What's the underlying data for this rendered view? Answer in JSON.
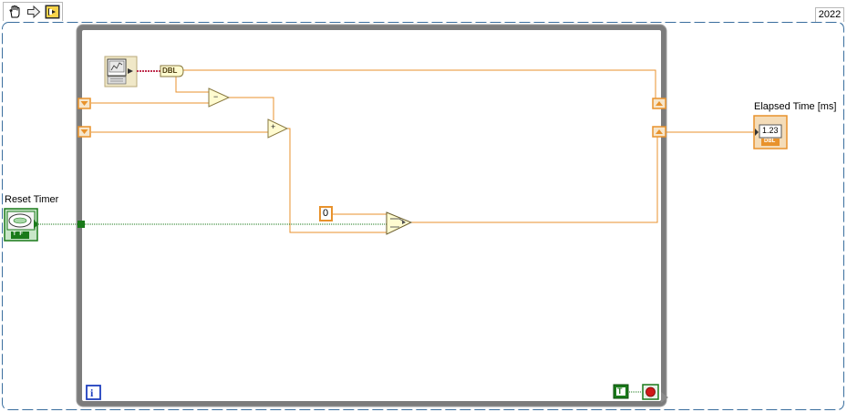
{
  "toolbar": {
    "buttons": [
      {
        "icon": "hand-operate-icon"
      },
      {
        "icon": "arrow-run-icon"
      },
      {
        "icon": "run-continuous-icon"
      }
    ]
  },
  "version": "2022",
  "controls": {
    "reset_timer_label": "Reset Timer",
    "reset_timer_boolean": "T F"
  },
  "indicators": {
    "elapsed_time_label": "Elapsed Time [ms]",
    "elapsed_time_display": "1.23",
    "elapsed_time_type": "DBL"
  },
  "diagram": {
    "tick_type": "DBL",
    "zero_constant": "0",
    "subtract_symbol": "−",
    "add_symbol": "+",
    "iteration_terminal": "i",
    "true_constant": "T"
  },
  "colors": {
    "orange_wire": "#e8922c",
    "green_wire": "#1a7a1a",
    "loop_frame": "#7c7c7c",
    "yellow_node": "#fffbd0"
  }
}
